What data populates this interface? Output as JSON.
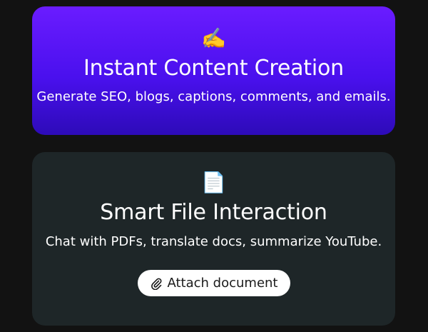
{
  "cards": [
    {
      "emoji": "✍️",
      "emoji_name": "writing-hand-icon",
      "title": "Instant Content Creation",
      "description": "Generate SEO, blogs, captions, comments, and emails.",
      "accent": "#5a16f5"
    },
    {
      "emoji": "📄",
      "emoji_name": "page-document-icon",
      "title": "Smart File Interaction",
      "description": "Chat with PDFs, translate docs, summarize YouTube.",
      "accent": "#1e2628",
      "button": {
        "label": "Attach document",
        "icon": "paperclip-icon"
      }
    }
  ]
}
